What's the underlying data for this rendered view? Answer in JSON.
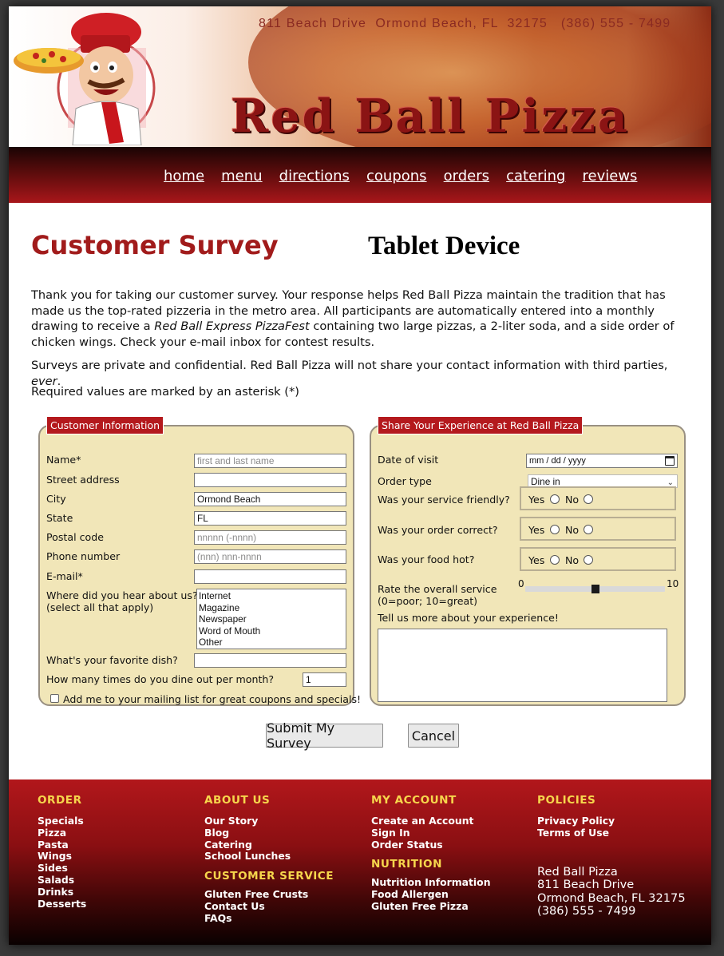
{
  "header": {
    "contact_line": "811 Beach Drive  Ormond Beach, FL  32175   (386) 555 - 7499",
    "brand": "Red Ball Pizza"
  },
  "nav": [
    "home",
    "menu",
    "directions",
    "coupons",
    "orders",
    "catering",
    "reviews"
  ],
  "main": {
    "title": "Customer Survey",
    "device_label": "Tablet Device",
    "intro_part1": "Thank you for taking our customer survey. Your response helps Red Ball Pizza maintain the tradition that has made us the top-rated pizzeria in the metro area. All participants are automatically entered into a monthly drawing to receive a ",
    "intro_em": "Red Ball Express PizzaFest",
    "intro_part2": " containing two large pizzas, a 2-liter soda, and a side order of chicken wings. Check your e-mail inbox for contest results.",
    "privacy_part1": "Surveys are private and confidential. Red Ball Pizza will not share your contact information with third parties, ",
    "privacy_em": "ever",
    "privacy_end": ".",
    "required_note": "Required values are marked by an asterisk (*)"
  },
  "customer_info": {
    "legend": "Customer Information",
    "name_label": "Name*",
    "name_placeholder": "first and last name",
    "street_label": "Street address",
    "street_value": "",
    "city_label": "City",
    "city_value": "Ormond Beach",
    "state_label": "State",
    "state_value": "FL",
    "postal_label": "Postal code",
    "postal_placeholder": "nnnnn (-nnnn)",
    "phone_label": "Phone number",
    "phone_placeholder": "(nnn) nnn-nnnn",
    "email_label": "E-mail*",
    "hear_label_1": "Where did you hear about us?",
    "hear_label_2": "(select all that apply)",
    "hear_options": [
      "Internet",
      "Magazine",
      "Newspaper",
      "Word of Mouth",
      "Other"
    ],
    "dish_label": "What's your favorite dish?",
    "dine_label": "How many times do you dine out per month?",
    "dine_value": "1",
    "mailing_label": "Add me to your mailing list for great coupons and specials!",
    "mailing_checked": false
  },
  "experience": {
    "legend": "Share Your Experience at Red Ball Pizza",
    "date_label": "Date of visit",
    "date_value": "mm / dd / yyyy",
    "order_type_label": "Order type",
    "order_type_value": "Dine in",
    "friendly_label": "Was your service friendly?",
    "correct_label": "Was your order correct?",
    "hot_label": "Was your food hot?",
    "yes": "Yes",
    "no": "No",
    "rate_label_1": "Rate the overall service",
    "rate_label_2": "(0=poor; 10=great)",
    "rate_min": "0",
    "rate_max": "10",
    "rate_value": 5,
    "more_label": "Tell us more about your experience!"
  },
  "buttons": {
    "submit": "Submit My Survey",
    "cancel": "Cancel"
  },
  "footer": {
    "order": {
      "heading": "ORDER",
      "links": [
        "Specials",
        "Pizza",
        "Pasta",
        "Wings",
        "Sides",
        "Salads",
        "Drinks",
        "Desserts"
      ]
    },
    "about": {
      "heading": "ABOUT US",
      "links": [
        "Our Story",
        "Blog",
        "Catering",
        "School Lunches"
      ]
    },
    "service": {
      "heading": "CUSTOMER SERVICE",
      "links": [
        "Gluten Free Crusts",
        "Contact Us",
        "FAQs"
      ]
    },
    "account": {
      "heading": "MY ACCOUNT",
      "links": [
        "Create an Account",
        "Sign In",
        "Order Status"
      ]
    },
    "nutrition": {
      "heading": "NUTRITION",
      "links": [
        "Nutrition Information",
        "Food Allergen",
        "Gluten Free Pizza"
      ]
    },
    "policies": {
      "heading": "POLICIES",
      "links": [
        "Privacy Policy",
        "Terms of Use"
      ]
    },
    "address": [
      "Red Ball Pizza",
      "811 Beach Drive",
      "Ormond Beach, FL 32175",
      "(386) 555 - 7499"
    ]
  },
  "colors": {
    "brand_red": "#a11b1b",
    "legend_red": "#b4191d",
    "fieldset_bg": "#f1e6b8",
    "footer_heading": "#f6d64c"
  }
}
